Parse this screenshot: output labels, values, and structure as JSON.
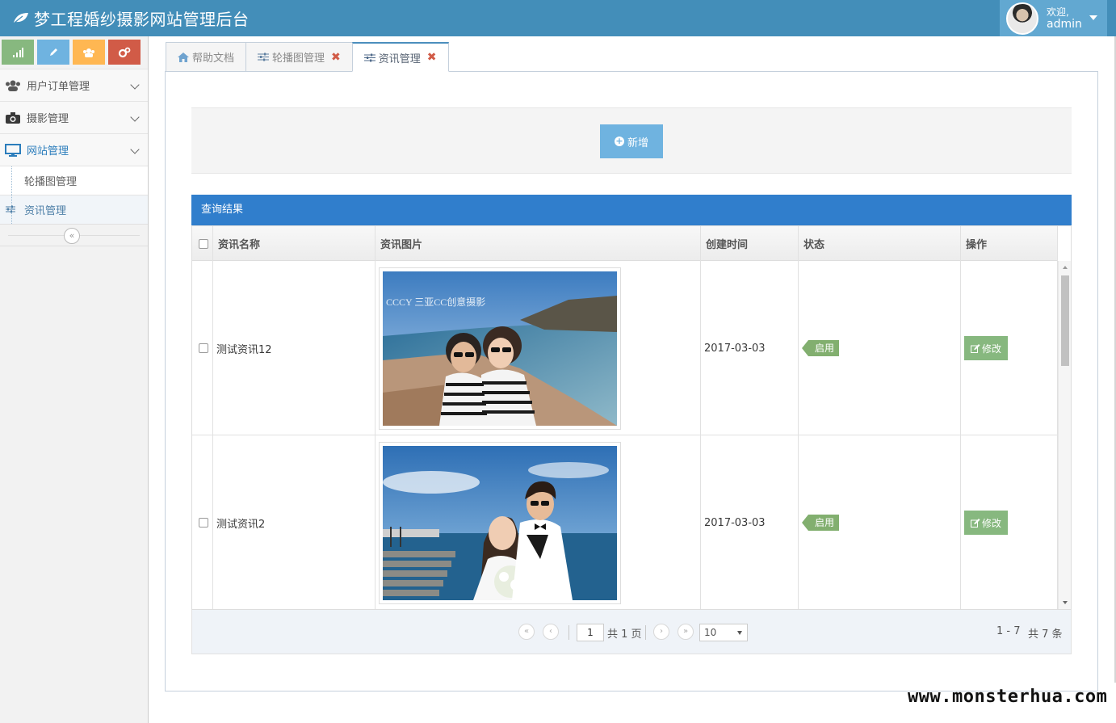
{
  "app": {
    "title": "梦工程婚纱摄影网站管理后台"
  },
  "user": {
    "greeting": "欢迎,",
    "name": "admin"
  },
  "shortcuts": [
    {
      "icon": "signal-icon",
      "color": "#87b87f"
    },
    {
      "icon": "pencil-icon",
      "color": "#6fb3e0"
    },
    {
      "icon": "users-icon",
      "color": "#ffb752"
    },
    {
      "icon": "cogs-icon",
      "color": "#d15b47"
    }
  ],
  "sidebar": {
    "items": [
      {
        "label": "用户订单管理",
        "icon": "users-icon"
      },
      {
        "label": "摄影管理",
        "icon": "camera-icon"
      },
      {
        "label": "网站管理",
        "icon": "desktop-icon",
        "open": true
      }
    ],
    "subitems": [
      {
        "label": "轮播图管理"
      },
      {
        "label": "资讯管理",
        "active": true
      }
    ],
    "collapse_symbol": "«"
  },
  "tabs": [
    {
      "label": "帮助文档",
      "icon": "home-icon"
    },
    {
      "label": "轮播图管理",
      "icon": "sliders-icon",
      "close": "✖"
    },
    {
      "label": "资讯管理",
      "icon": "sliders-icon",
      "close": "✖",
      "active": true
    }
  ],
  "toolbar": {
    "add_label": "新增"
  },
  "grid": {
    "caption": "查询结果",
    "columns": [
      "资讯名称",
      "资讯图片",
      "创建时间",
      "状态",
      "操作"
    ],
    "rows": [
      {
        "name": "测试资讯12",
        "date": "2017-03-03",
        "status": "启用",
        "action": "修改",
        "photo_watermark": "CCCY 三亚CC创意摄影"
      },
      {
        "name": "测试资讯2",
        "date": "2017-03-03",
        "status": "启用",
        "action": "修改"
      }
    ]
  },
  "pager": {
    "first": "«",
    "prev": "‹",
    "next": "›",
    "last": "»",
    "current_page": "1",
    "total_pages_text": "共 1 页",
    "page_size": "10",
    "range_text": "1 - 7",
    "total_text": "共 7 条"
  },
  "watermark": "www.monsterhua.com",
  "colors": {
    "navbar": "#438eb9",
    "user_box": "#62a8d1",
    "caption": "#307ecc",
    "add_button": "#6fb3e0",
    "status_badge": "#82af6f",
    "edit_button": "#87b87f"
  }
}
